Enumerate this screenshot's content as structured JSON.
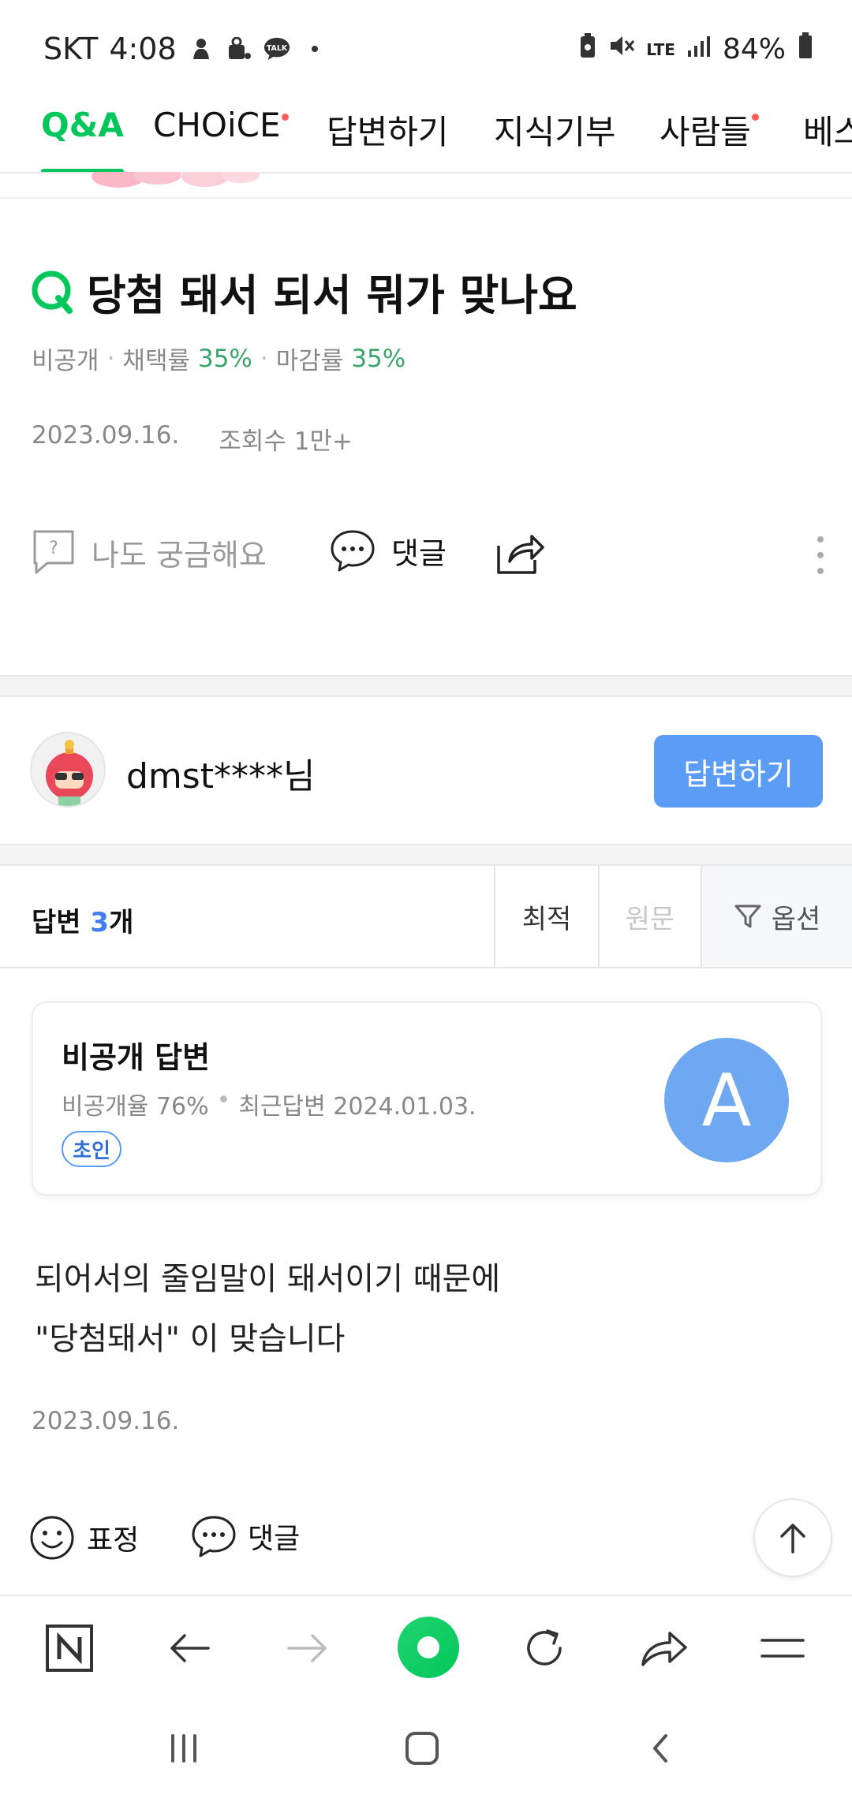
{
  "status_bar": {
    "carrier": "SKT",
    "time": "4:08",
    "network": "LTE",
    "battery": "84%"
  },
  "tabs": [
    {
      "label": "Q&A",
      "active": true,
      "dot": false
    },
    {
      "label": "CHOiCE",
      "active": false,
      "dot": true
    },
    {
      "label": "답변하기",
      "active": false,
      "dot": false
    },
    {
      "label": "지식기부",
      "active": false,
      "dot": false
    },
    {
      "label": "사람들",
      "active": false,
      "dot": true
    },
    {
      "label": "베스",
      "active": false,
      "dot": false
    }
  ],
  "question": {
    "title": "당첨 돼서 되서 뭐가 맞나요",
    "visibility": "비공개",
    "adopt_label": "채택률",
    "adopt_rate": "35%",
    "deadline_label": "마감률",
    "deadline_rate": "35%",
    "date": "2023.09.16.",
    "views": "조회수 1만+",
    "curious_label": "나도 궁금해요",
    "comment_label": "댓글"
  },
  "user": {
    "name": "dmst****님",
    "answer_button": "답변하기"
  },
  "answers_bar": {
    "label": "답변",
    "count": "3",
    "suffix": "개",
    "sort_best": "최적",
    "sort_original": "원문",
    "options": "옵션"
  },
  "answer_card": {
    "title": "비공개 답변",
    "private_rate": "비공개율 76%",
    "recent": "최근답변 2024.01.03.",
    "badge": "초인",
    "avatar_letter": "A"
  },
  "answer": {
    "line1": "되어서의 줄임말이 돼서이기 때문에",
    "line2": "\"당첨돼서\" 이 맞습니다",
    "date": "2023.09.16.",
    "emoji_label": "표정",
    "comment_label": "댓글"
  },
  "colors": {
    "accent_green": "#03c75a",
    "button_blue": "#5b9cf6",
    "count_blue": "#3d7df0",
    "rate_green": "#3aa46a"
  }
}
